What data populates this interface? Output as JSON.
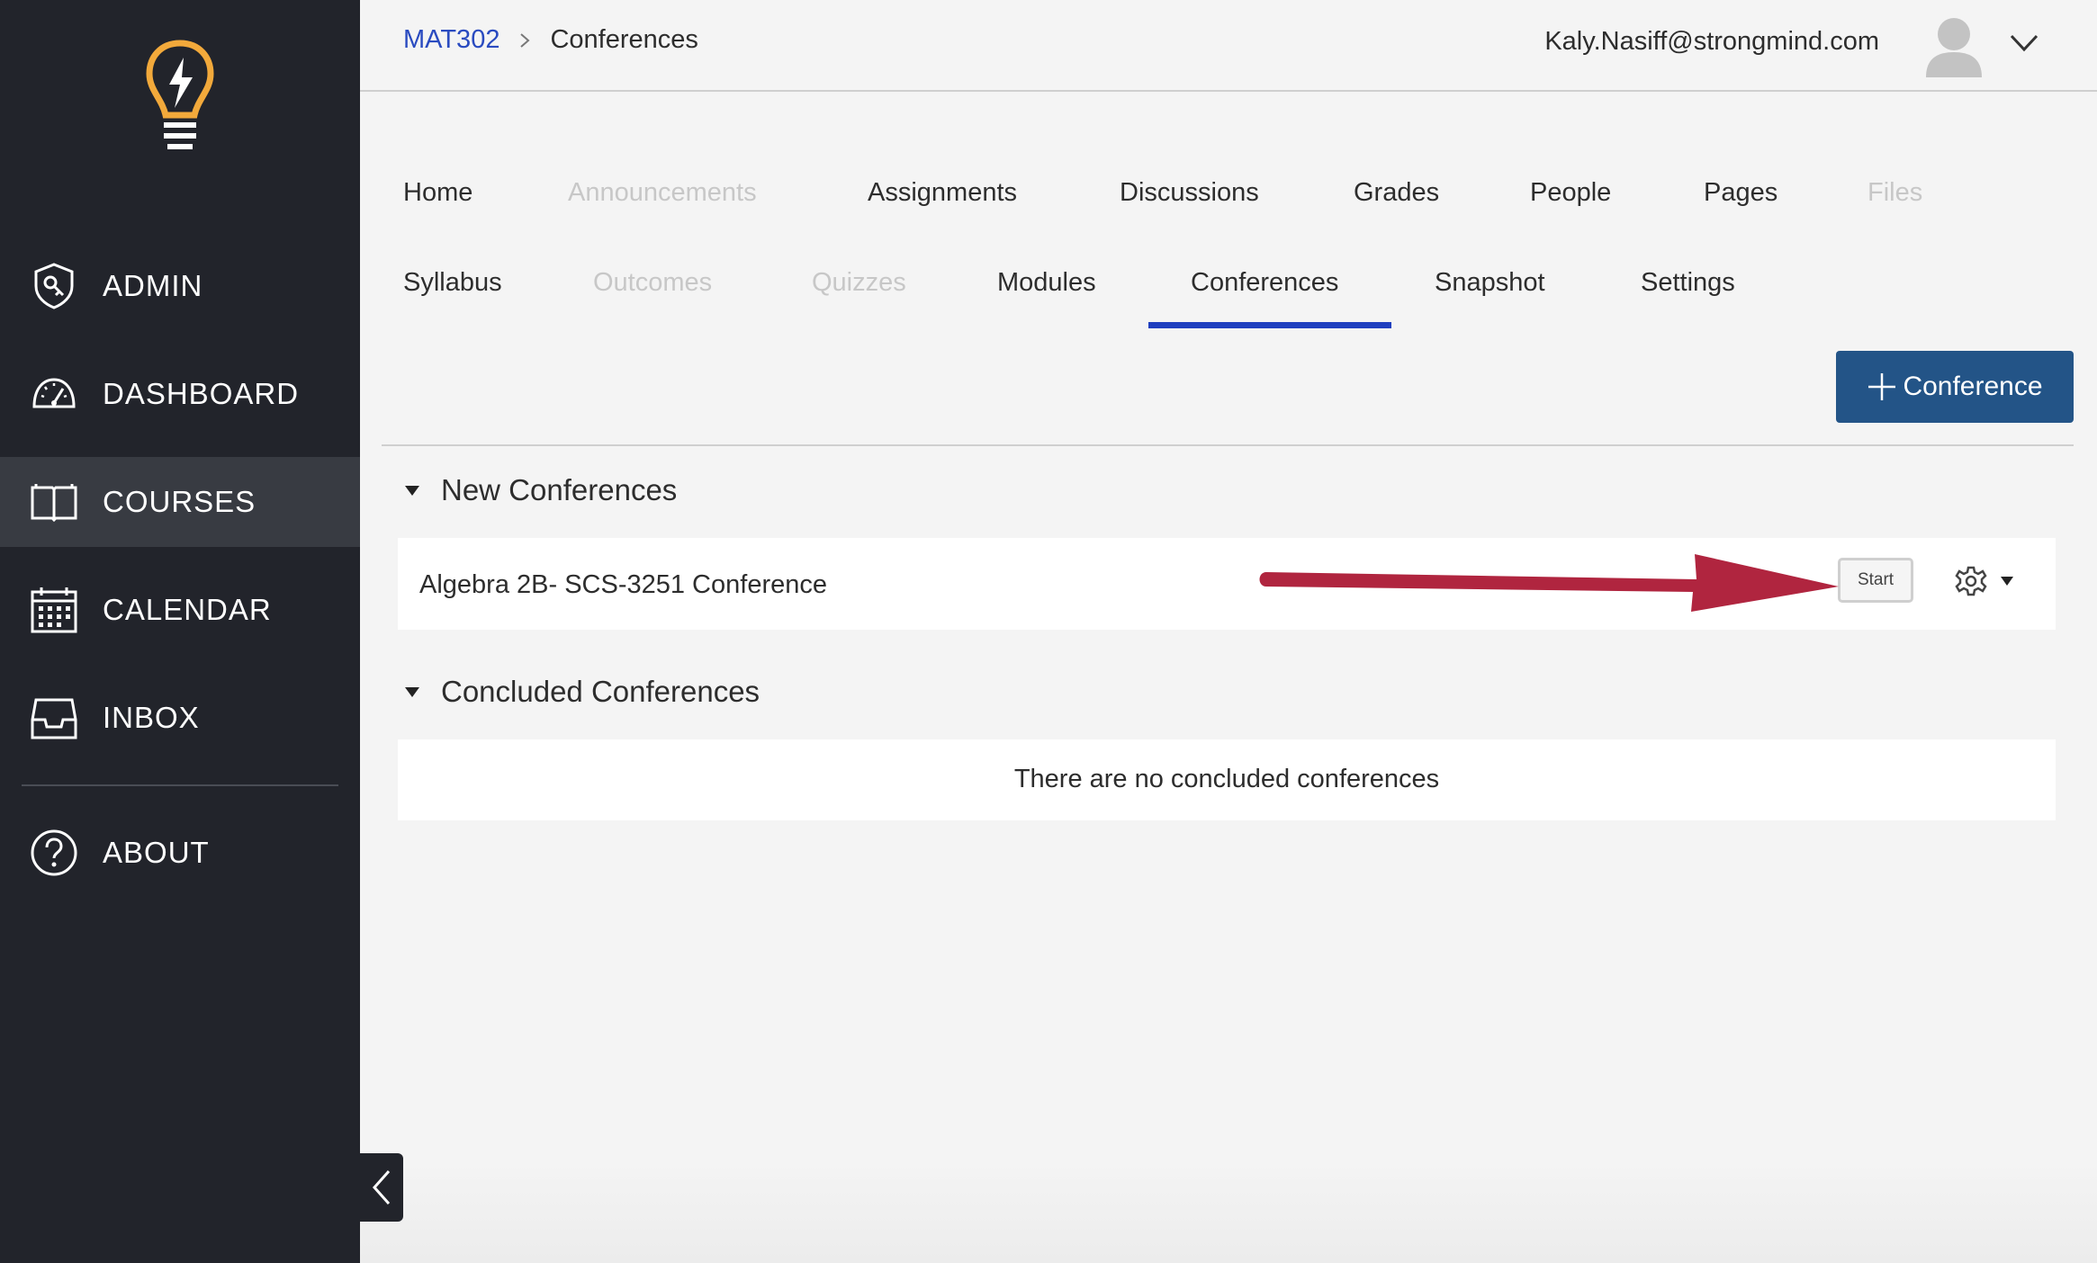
{
  "sidebar": {
    "items": [
      {
        "label": "ADMIN",
        "icon": "shield-key-icon"
      },
      {
        "label": "DASHBOARD",
        "icon": "speedometer-icon"
      },
      {
        "label": "COURSES",
        "icon": "book-icon",
        "active": true
      },
      {
        "label": "CALENDAR",
        "icon": "calendar-icon"
      },
      {
        "label": "INBOX",
        "icon": "inbox-icon"
      }
    ],
    "about": {
      "label": "ABOUT",
      "icon": "help-circle-icon"
    }
  },
  "header": {
    "breadcrumb": {
      "course": "MAT302",
      "current": "Conferences"
    },
    "user_email": "Kaly.Nasiff@strongmind.com"
  },
  "tabs": [
    {
      "label": "Home",
      "disabled": false
    },
    {
      "label": "Announcements",
      "disabled": true
    },
    {
      "label": "Assignments",
      "disabled": false
    },
    {
      "label": "Discussions",
      "disabled": false
    },
    {
      "label": "Grades",
      "disabled": false
    },
    {
      "label": "People",
      "disabled": false
    },
    {
      "label": "Pages",
      "disabled": false
    },
    {
      "label": "Files",
      "disabled": true
    },
    {
      "label": "Syllabus",
      "disabled": false
    },
    {
      "label": "Outcomes",
      "disabled": true
    },
    {
      "label": "Quizzes",
      "disabled": true
    },
    {
      "label": "Modules",
      "disabled": false
    },
    {
      "label": "Conferences",
      "disabled": false,
      "active": true
    },
    {
      "label": "Snapshot",
      "disabled": false
    },
    {
      "label": "Settings",
      "disabled": false
    }
  ],
  "toolbar": {
    "add_conference_label": "Conference"
  },
  "new_conferences": {
    "title": "New Conferences",
    "items": [
      {
        "name": "Algebra 2B- SCS-3251 Conference",
        "action": "Start"
      }
    ]
  },
  "concluded_conferences": {
    "title": "Concluded Conferences",
    "empty_text": "There are no concluded conferences"
  },
  "colors": {
    "sidebar_bg": "#22242b",
    "sidebar_active": "#383b42",
    "accent_blue": "#1f3fbf",
    "button_blue": "#235487",
    "annotation_arrow": "#b0253f",
    "logo_yellow": "#f2a93b"
  }
}
